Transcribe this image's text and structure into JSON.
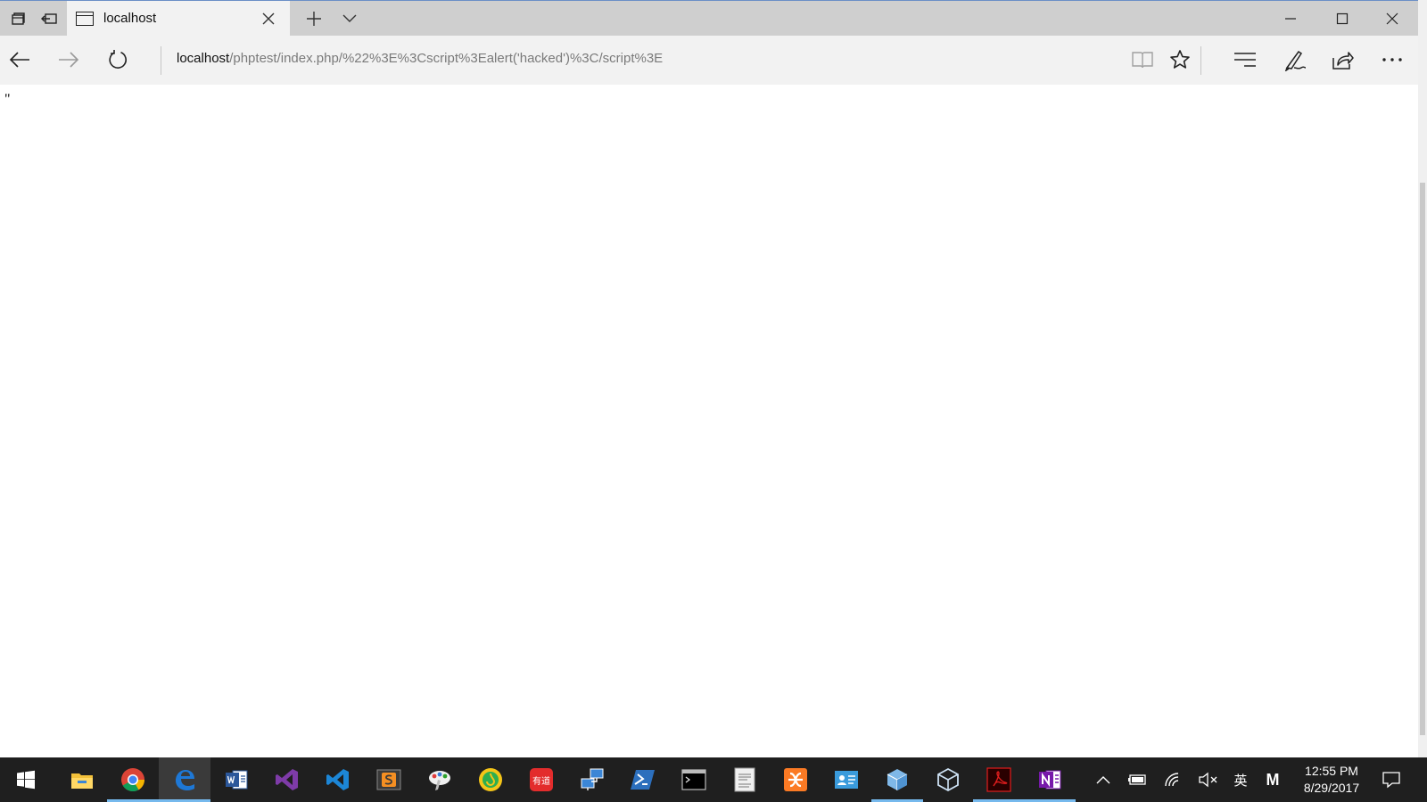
{
  "tab": {
    "title": "localhost"
  },
  "address": {
    "host": "localhost",
    "path": "/phptest/index.php/%22%3E%3Cscript%3Ealert('hacked')%3C/script%3E"
  },
  "page": {
    "content_text": "\""
  },
  "icons": {
    "titlebar": [
      "tab-preview-icon",
      "set-aside-tabs-icon",
      "new-tab-icon",
      "tab-list-chevron-icon"
    ],
    "window_controls": [
      "minimize-icon",
      "maximize-icon",
      "close-icon"
    ],
    "nav": [
      "back-arrow-icon",
      "forward-arrow-icon",
      "refresh-icon",
      "reading-view-icon",
      "favorite-star-icon",
      "hub-icon",
      "web-note-pen-icon",
      "share-icon",
      "more-dots-icon"
    ],
    "taskbar": [
      "windows-start-icon",
      "file-explorer-icon",
      "chrome-icon",
      "edge-icon",
      "word-icon",
      "visual-studio-icon",
      "vscode-icon",
      "sublime-text-icon",
      "paint-icon",
      "music-app-icon",
      "youdao-dict-icon",
      "remote-desktop-icon",
      "powershell-icon",
      "terminal-icon",
      "digital-paper-icon",
      "xampp-icon",
      "contacts-app-icon",
      "3d-builder-icon",
      "virtualbox-icon",
      "acrobat-icon",
      "onenote-icon"
    ],
    "tray": [
      "show-hidden-chevron-icon",
      "battery-icon",
      "wifi-icon",
      "volume-muted-icon",
      "ime-chinese-icon",
      "ime-mode-icon",
      "action-center-icon"
    ]
  },
  "taskbar": {
    "youdao_label": "有道"
  },
  "tray": {
    "ime_label": "英",
    "ime_mode": "M"
  },
  "clock": {
    "time": "12:55 PM",
    "date": "8/29/2017"
  },
  "colors": {
    "taskbar_bg": "#1f1f1f",
    "running_indicator": "#76b9ed",
    "edge_blue": "#1e78d6"
  }
}
